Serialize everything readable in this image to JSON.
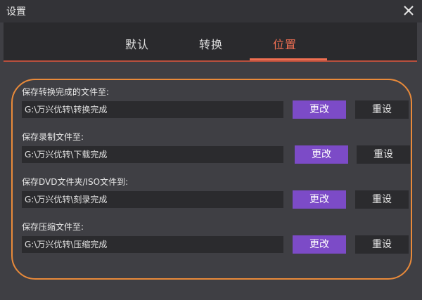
{
  "window": {
    "title": "设置"
  },
  "tabs": [
    {
      "label": "默认"
    },
    {
      "label": "转换"
    },
    {
      "label": "位置",
      "active": true
    }
  ],
  "settings": [
    {
      "label": "保存转换完成的文件至:",
      "path": "G:\\万兴优转\\转换完成",
      "change_label": "更改",
      "reset_label": "重设"
    },
    {
      "label": "保存录制文件至:",
      "path": "G:\\万兴优转\\下载完成",
      "change_label": "更改",
      "reset_label": "重设"
    },
    {
      "label": "保存DVD文件夹/ISO文件到:",
      "path": "G:\\万兴优转\\刻录完成",
      "change_label": "更改",
      "reset_label": "重设"
    },
    {
      "label": "保存压缩文件至:",
      "path": "G:\\万兴优转\\压缩完成",
      "change_label": "更改",
      "reset_label": "重设"
    }
  ],
  "colors": {
    "accent": "#ef6f52",
    "button_primary": "#7c4bc7",
    "highlight_outline": "#e98a3a"
  },
  "icons": {
    "close": "close-icon"
  }
}
